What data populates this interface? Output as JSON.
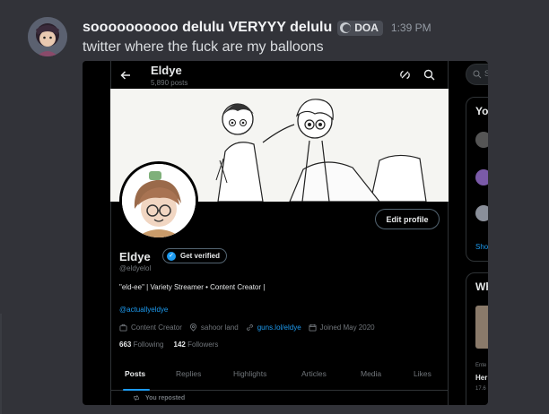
{
  "message": {
    "username": "soooooooooo delulu VERYYY delulu",
    "tag": "DOA",
    "timestamp": "1:39 PM",
    "content": "twitter where the fuck are my balloons"
  },
  "twitter": {
    "display_name": "Eldye",
    "post_count": "5,890 posts",
    "edit_profile_label": "Edit profile",
    "get_verified_label": "Get verified",
    "handle": "@eldyelol",
    "bio": "\"eld-ee\"  | Variety Streamer • Content Creator |",
    "bio_link": "@actuallyeldye",
    "meta": {
      "category": "Content Creator",
      "location": "sahoor land",
      "url": "guns.lol/eldye",
      "joined": "Joined May 2020"
    },
    "following_count": "663",
    "following_label": "Following",
    "followers_count": "142",
    "followers_label": "Followers",
    "tabs": [
      "Posts",
      "Replies",
      "Highlights",
      "Articles",
      "Media",
      "Likes"
    ],
    "active_tab": "Posts",
    "reposted_label": "You reposted"
  },
  "sidebar": {
    "search_placeholder": "S",
    "card1_heading": "Yo",
    "card1_link": "Sho",
    "card2_heading": "Wh",
    "item_meta": "Ente",
    "item_title": "Her",
    "item_count": "17.6"
  },
  "colors": {
    "discord_bg": "#323339",
    "twitter_bg": "#000000",
    "accent_blue": "#1d9bf0",
    "muted_text": "#71767b"
  }
}
